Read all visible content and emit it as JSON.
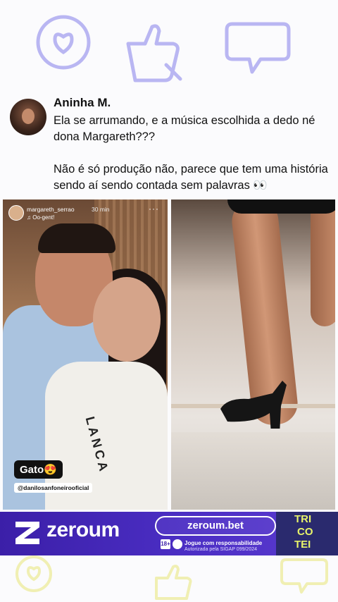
{
  "comment": {
    "author": "Aninha M.",
    "text_1": "Ela se arrumando, e a música escolhida a dedo né dona Margareth???",
    "text_2": "Não é só produção não, parece que tem uma história sendo aí sendo contada sem palavras 👀"
  },
  "story": {
    "username": "margareth_serrao",
    "time": "30 min",
    "more": "···",
    "music": "♫ Oo-gent!",
    "sticker": "Gato😍",
    "mention": "@danilosanfoneirooficial",
    "shirt_text": "LANCA"
  },
  "ad": {
    "brand": "zeroum",
    "url": "zeroum.bet",
    "badge": "18+",
    "responsibility": "Jogue com responsabilidade",
    "authorization": "Autorizada pela SIGAP 099/2024",
    "partner": [
      "TRI",
      "CO",
      "TEI"
    ]
  },
  "colors": {
    "doodle": "#b9b6f2",
    "doodle_bottom": "#f0efb3",
    "banner": "#3b1fa8",
    "partner_text": "#e8f46a"
  },
  "icons": [
    "heart-icon",
    "thumbs-up-icon",
    "chat-bubble-icon"
  ]
}
